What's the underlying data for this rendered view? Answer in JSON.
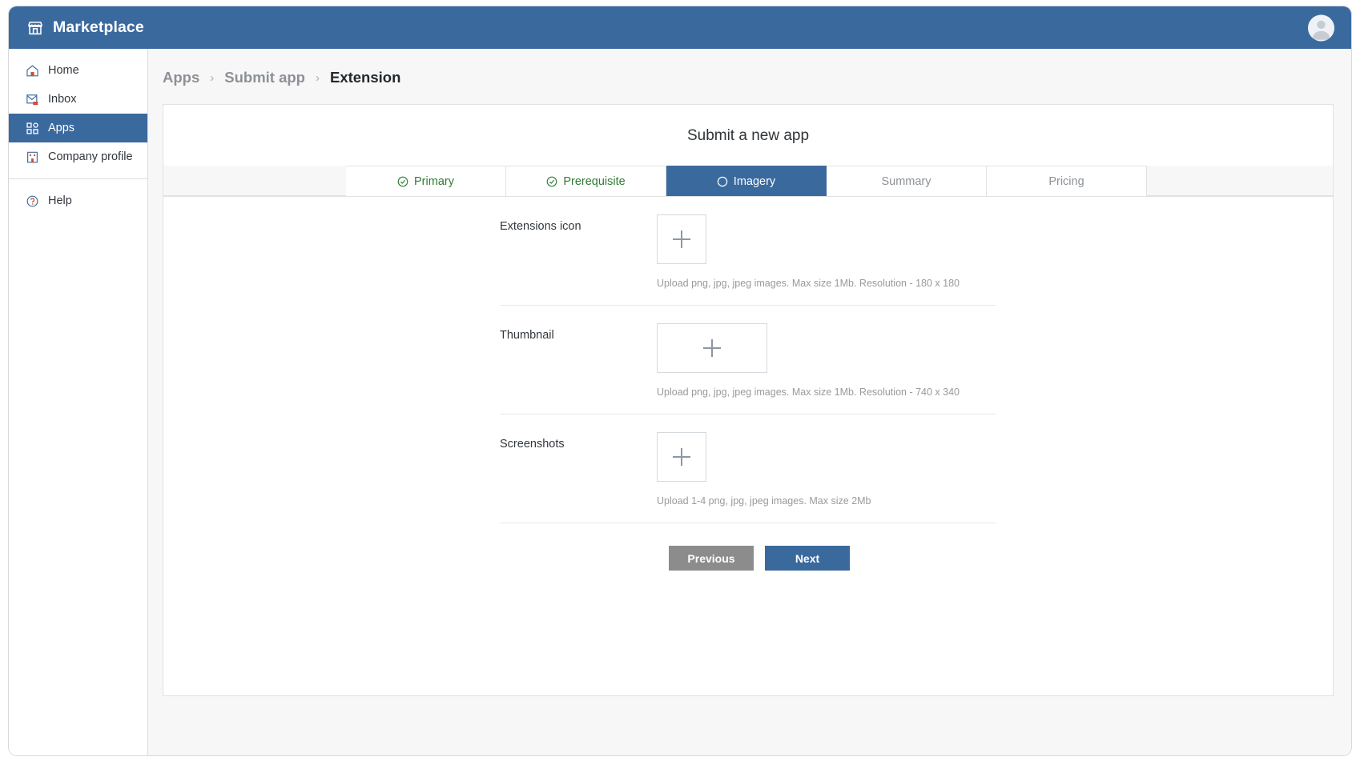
{
  "topbar": {
    "brand": "Marketplace",
    "brand_icon": "store-icon",
    "avatar_icon": "user-avatar-icon",
    "bg_color": "#3a699e"
  },
  "sidebar": {
    "items": [
      {
        "label": "Home",
        "icon": "home-icon",
        "active": false
      },
      {
        "label": "Inbox",
        "icon": "inbox-icon",
        "active": false
      },
      {
        "label": "Apps",
        "icon": "apps-grid-icon",
        "active": true
      },
      {
        "label": "Company profile",
        "icon": "company-profile-icon",
        "active": false
      }
    ],
    "footer_items": [
      {
        "label": "Help",
        "icon": "help-circle-icon",
        "active": false
      }
    ],
    "active_color": "#3a699e"
  },
  "breadcrumb": {
    "items": [
      "Apps",
      "Submit app",
      "Extension"
    ],
    "separator": "›",
    "current_index": 2
  },
  "card": {
    "title": "Submit a new app"
  },
  "tabs": [
    {
      "label": "Primary",
      "icon": "check-circle-icon",
      "state": "done"
    },
    {
      "label": "Prerequisite",
      "icon": "check-circle-icon",
      "state": "done"
    },
    {
      "label": "Imagery",
      "icon": "empty-circle-icon",
      "state": "active"
    },
    {
      "label": "Summary",
      "icon": "",
      "state": "default"
    },
    {
      "label": "Pricing",
      "icon": "",
      "state": "default"
    }
  ],
  "upload_rows": [
    {
      "label": "Extensions icon",
      "dropzone_icon": "plus-icon",
      "dropzone_size": "square",
      "hint": "Upload png, jpg, jpeg images. Max size 1Mb. Resolution - 180 x 180"
    },
    {
      "label": "Thumbnail",
      "dropzone_icon": "plus-icon",
      "dropzone_size": "wide",
      "hint": "Upload png, jpg, jpeg images. Max size 1Mb. Resolution - 740 x 340"
    },
    {
      "label": "Screenshots",
      "dropzone_icon": "plus-icon",
      "dropzone_size": "square",
      "hint": "Upload 1-4 png, jpg, jpeg images. Max size 2Mb"
    }
  ],
  "actions": {
    "previous_label": "Previous",
    "next_label": "Next",
    "previous_color": "#8c8c8c",
    "next_color": "#3a699e"
  }
}
